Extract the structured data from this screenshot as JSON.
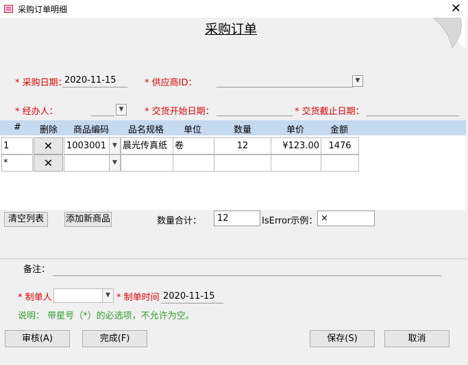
{
  "window": {
    "title": "采购订单明细",
    "close_glyph": "✕"
  },
  "heading": "采购订单",
  "fields": {
    "purchase_date_label": "* 采购日期：",
    "purchase_date_value": "2020-11-15",
    "supplier_label": "* 供应商ID：",
    "supplier_value": "",
    "handler_label": "* 经办人：",
    "handler_value": "",
    "delivery_start_label": "* 交货开始日期：",
    "delivery_start_value": "",
    "delivery_end_label": "* 交货截止日期：",
    "delivery_end_value": ""
  },
  "grid": {
    "headers": [
      "#",
      "删除",
      "商品编码",
      "品名规格",
      "单位",
      "数量",
      "单价",
      "金额"
    ],
    "rows": [
      {
        "index": "1",
        "delete": "✕",
        "code": "1003001",
        "name": "晨光传真纸",
        "unit": "卷",
        "qty": "12",
        "price": "¥123.00",
        "amount": "1476"
      },
      {
        "index": "*",
        "delete": "✕",
        "code": "",
        "name": "",
        "unit": "",
        "qty": "",
        "price": "",
        "amount": ""
      }
    ]
  },
  "actions": {
    "clear_list": "清空列表",
    "add_product": "添加新商品",
    "qty_total_label": "数量合计：",
    "qty_total_value": "12",
    "iserror_label": "IsError示例：",
    "iserror_value": "×"
  },
  "remarks": {
    "label": "备注：",
    "value": ""
  },
  "creator": {
    "creator_label": "* 制单人",
    "creator_value": "",
    "time_label": "* 制单时间",
    "time_value": "2020-11-15"
  },
  "note": "说明： 带星号（*）的必选项，不允许为空。",
  "buttons": {
    "review": "审核(A)",
    "done": "完成(F)",
    "save": "保存(S)",
    "cancel": "取消"
  },
  "colors": {
    "required": "#e00000",
    "note": "#2ea02e",
    "grid_header": "#c5d9ef"
  },
  "icons": {
    "dropdown": "chevron-down-icon",
    "delete": "close-icon"
  }
}
